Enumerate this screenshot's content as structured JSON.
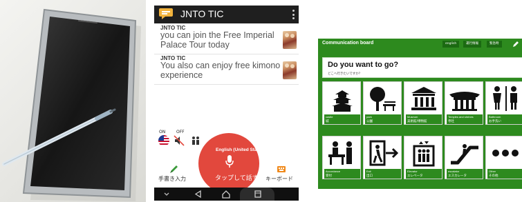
{
  "app": {
    "title": "JNTO TIC",
    "messages": [
      {
        "sender": "JNTO TIC",
        "text": "you can join the Free Imperial Palace Tour today"
      },
      {
        "sender": "JNTO TIC",
        "text": "You also can enjoy free kimono  experience"
      }
    ],
    "controls": {
      "on_label": "ON",
      "off_label": "OFF"
    },
    "language_label": "English (United States)",
    "mic_label": "タップして話す",
    "handwriting_label": "手書き入力",
    "keyboard_label": "キーボード",
    "icons": [
      "chat-logo-icon",
      "menu-dots-icon",
      "us-flag-icon",
      "speaker-mute-icon",
      "people-icon",
      "microphone-icon",
      "pencil-icon",
      "keyboard-icon",
      "back-icon",
      "home-icon",
      "recents-icon",
      "down-chevron-icon"
    ],
    "colors": {
      "header": "#1f1f1f",
      "mic_button": "#e2483d",
      "accent_green": "#3a9a3a",
      "navbar": "#101010"
    }
  },
  "board": {
    "title": "Communication board",
    "tabs": [
      "english",
      "運行情報",
      "緊急時"
    ],
    "question": "Do you want to go?",
    "question_sub": "どこへ行きたいですか？",
    "tiles": [
      {
        "en": "castle",
        "jp": "城"
      },
      {
        "en": "park",
        "jp": "公園"
      },
      {
        "en": "Museum",
        "jp": "美術館/博物館"
      },
      {
        "en": "Temples and shrines",
        "jp": "寺社"
      },
      {
        "en": "Bathroom",
        "jp": "お手洗い"
      },
      {
        "en": "Accordance",
        "jp": "受付"
      },
      {
        "en": "Exit",
        "jp": "出口"
      },
      {
        "en": "Elevator",
        "jp": "エレベータ"
      },
      {
        "en": "escalator",
        "jp": "エスカレータ"
      },
      {
        "en": "Other",
        "jp": "その他"
      }
    ],
    "colors": {
      "board_green": "#2d8a1e",
      "tab_dark": "#1b6a12"
    }
  }
}
